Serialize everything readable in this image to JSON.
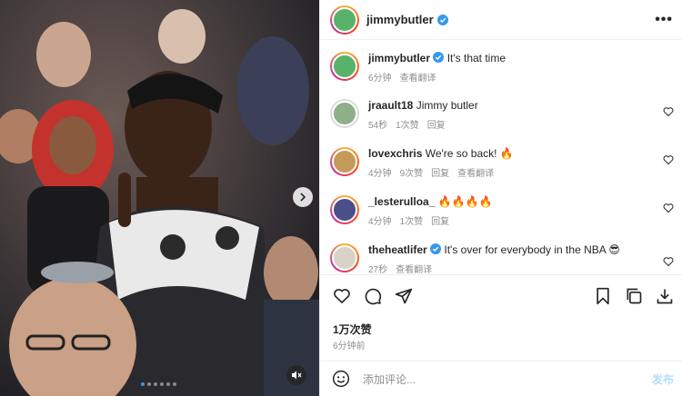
{
  "header": {
    "username": "jimmybutler",
    "more_label": "•••"
  },
  "caption": {
    "username": "jimmybutler",
    "text": "It's that time",
    "time": "6分钟",
    "translate": "查看翻译"
  },
  "comments": [
    {
      "username": "jraault18",
      "text": "Jimmy butler",
      "time": "54秒",
      "likes": "1次赞",
      "reply": "回复",
      "translate": ""
    },
    {
      "username": "lovexchris",
      "text": "We're so back! 🔥",
      "time": "4分钟",
      "likes": "9次赞",
      "reply": "回复",
      "translate": "查看翻译"
    },
    {
      "username": "_lesterulloa_",
      "text": "🔥🔥🔥🔥",
      "time": "4分钟",
      "likes": "1次赞",
      "reply": "回复",
      "translate": ""
    },
    {
      "username": "theheatlifer",
      "text": "It's over for everybody in the NBA 😎",
      "time": "27秒",
      "likes": "",
      "reply": "查看翻译",
      "translate": ""
    }
  ],
  "footer": {
    "likes_count": "1万次赞",
    "posted_ago": "6分钟前"
  },
  "composer": {
    "placeholder": "添加评论...",
    "post_label": "发布"
  },
  "icons": {
    "like": "heart-icon",
    "comment": "comment-icon",
    "share": "send-icon",
    "save": "bookmark-icon",
    "collab": "copy-icon",
    "download": "download-icon",
    "emoji": "smiley-icon",
    "next": "chevron-right-icon",
    "mute": "speaker-muted-icon"
  },
  "colors": {
    "verified": "#3897f0",
    "post_disabled": "#b2dffc",
    "muted_text": "#8e8e8e"
  },
  "carousel": {
    "slides": 6,
    "active_index": 0
  }
}
